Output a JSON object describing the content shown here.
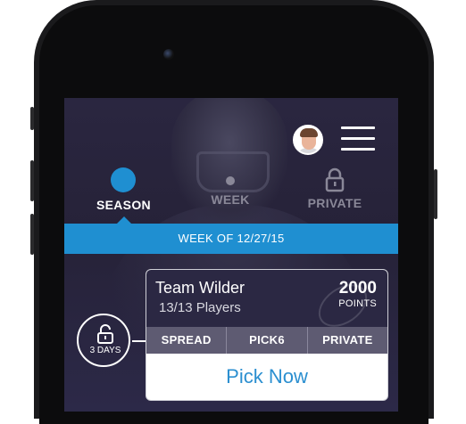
{
  "header": {
    "avatar_alt": "user-avatar",
    "menu_icon": "hamburger-menu-icon"
  },
  "tabs": [
    {
      "label": "SEASON",
      "active": true
    },
    {
      "label": "WEEK",
      "active": false
    },
    {
      "label": "PRIVATE",
      "active": false
    }
  ],
  "week_banner": "WEEK OF 12/27/15",
  "lock_badge": {
    "label": "3 DAYS"
  },
  "card": {
    "team_name": "Team Wilder",
    "players": "13/13 Players",
    "points_value": "2000",
    "points_label": "POINTS",
    "tabs": [
      "SPREAD",
      "PICK6",
      "PRIVATE"
    ],
    "action": "Pick Now"
  },
  "colors": {
    "accent": "#1f8fd1",
    "background": "#2a2640",
    "card_header": "#2b2843"
  }
}
